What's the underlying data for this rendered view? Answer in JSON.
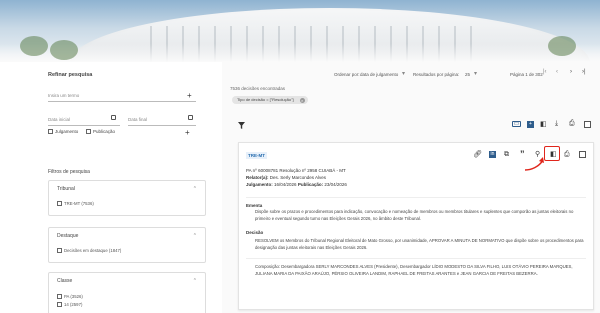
{
  "sidebar": {
    "refine_title": "Refinar pesquisa",
    "term_placeholder": "Insira um termo",
    "date_start": "Data inicial",
    "date_end": "Data final",
    "chk_julgamento": "Julgamento",
    "chk_publicacao": "Publicação",
    "filters_title": "Filtros de pesquisa",
    "filters": [
      {
        "title": "Tribunal",
        "items": [
          "TRE-MT (7536)"
        ]
      },
      {
        "title": "Destaque",
        "items": [
          "Decisões em destaque (1847)"
        ]
      },
      {
        "title": "Classe",
        "items": [
          "PA (3526)",
          "14 (2597)"
        ]
      }
    ]
  },
  "toolbar": {
    "order_label": "Ordenar por:",
    "order_value": "data de julgamento",
    "per_page_label": "Resultados por página:",
    "per_page_value": "25",
    "page_info": "Página 1 de 302"
  },
  "results": {
    "found": "7536 decisões encontradas",
    "chip": "Tipo de decisão = [\"Resolução\"]"
  },
  "card": {
    "court_tag": "TRE-MT",
    "process": "PA nº 60008781  Resolução nº 2958  CUIABÁ - MT",
    "relator_label": "Relator(a):",
    "relator": "Des. Serly Marcondes Alves",
    "julgamento_label": "Julgamento:",
    "julgamento": "16/04/2026",
    "publicacao_label": "Publicação:",
    "publicacao": "23/04/2026",
    "ementa_title": "Ementa",
    "ementa": "Dispõe sobre os prazos e procedimentos para indicação, convocação e nomeação de membros ou membros titulares e suplentes que comporão as juntas eleitorais no primeiro e eventual segundo turno nas Eleições Gerais 2026, no âmbito deste Tribunal.",
    "decisao_title": "Decisão",
    "decisao": "RESOLVEM os Membros do Tribunal Regional Eleitoral de Mato Grosso, por unanimidade, APROVAR A MINUTA DE NORMATIVO que dispõe sobre os procedimentos para designação das juntas eleitorais nas Eleições Gerais 2026.",
    "composicao": "Composição: Desembargadora SERLY MARCONDES ALVES (Presidente), Desembargador LÍDIO MODESTO DA SILVA FILHO, LUIS OTÁVIO PEREIRA MARQUES, JULIANA MARIA DA PAIXÃO ARAÚJO, PÉRSIO OLIVEIRA LANDIM, RAPHAEL DE FREITAS ARANTES e JEAN GARCIA DE FREITAS BEZERRA."
  },
  "icons": {
    "link": "link-icon",
    "copy_link": "copy-link-icon",
    "copy": "copy-icon",
    "quote": "quote-icon",
    "pin": "pin-icon",
    "library": "library-add-icon",
    "print": "print-icon"
  },
  "colors": {
    "accent": "#2f5d8c",
    "highlight": "#e0261c",
    "tag": "#2a6fb0"
  }
}
